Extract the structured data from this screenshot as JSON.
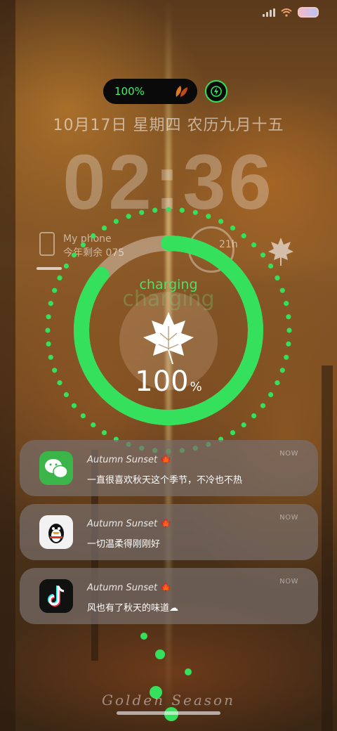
{
  "status_bar": {
    "signal_icon": "signal-icon",
    "wifi_icon": "wifi-icon",
    "battery_icon": "battery-icon"
  },
  "top_pill": {
    "battery_percent": "100%",
    "icon": "autumn-leaves-icon"
  },
  "charging_indicator": {
    "icon": "lightning-bolt-icon"
  },
  "date_line": "10月17日 星期四  农历九月十五",
  "clock": "02:36",
  "my_phone": {
    "name": "My phone",
    "subtitle": "今年剩余 075"
  },
  "ghost_widget": {
    "time_text": "21h",
    "label": "charging"
  },
  "charging_widget": {
    "label": "charging",
    "ghost_label": "charging",
    "level": 100,
    "percent_value": "100",
    "percent_sign": "%",
    "accent_color": "#35e05c",
    "icon": "maple-leaf-icon"
  },
  "notifications": [
    {
      "app_icon": "wechat-icon",
      "title": "Autumn Sunset",
      "emoji": "🍁",
      "message": "一直很喜欢秋天这个季节，不冷也不热",
      "time": "NOW"
    },
    {
      "app_icon": "qq-penguin-icon",
      "title": "Autumn Sunset",
      "emoji": "🍁",
      "message": "一切温柔得刚刚好",
      "time": "NOW"
    },
    {
      "app_icon": "tiktok-icon",
      "title": "Autumn Sunset",
      "emoji": "🍁",
      "message": "风也有了秋天的味道☁",
      "time": "NOW"
    }
  ],
  "signature": "Golden Season"
}
